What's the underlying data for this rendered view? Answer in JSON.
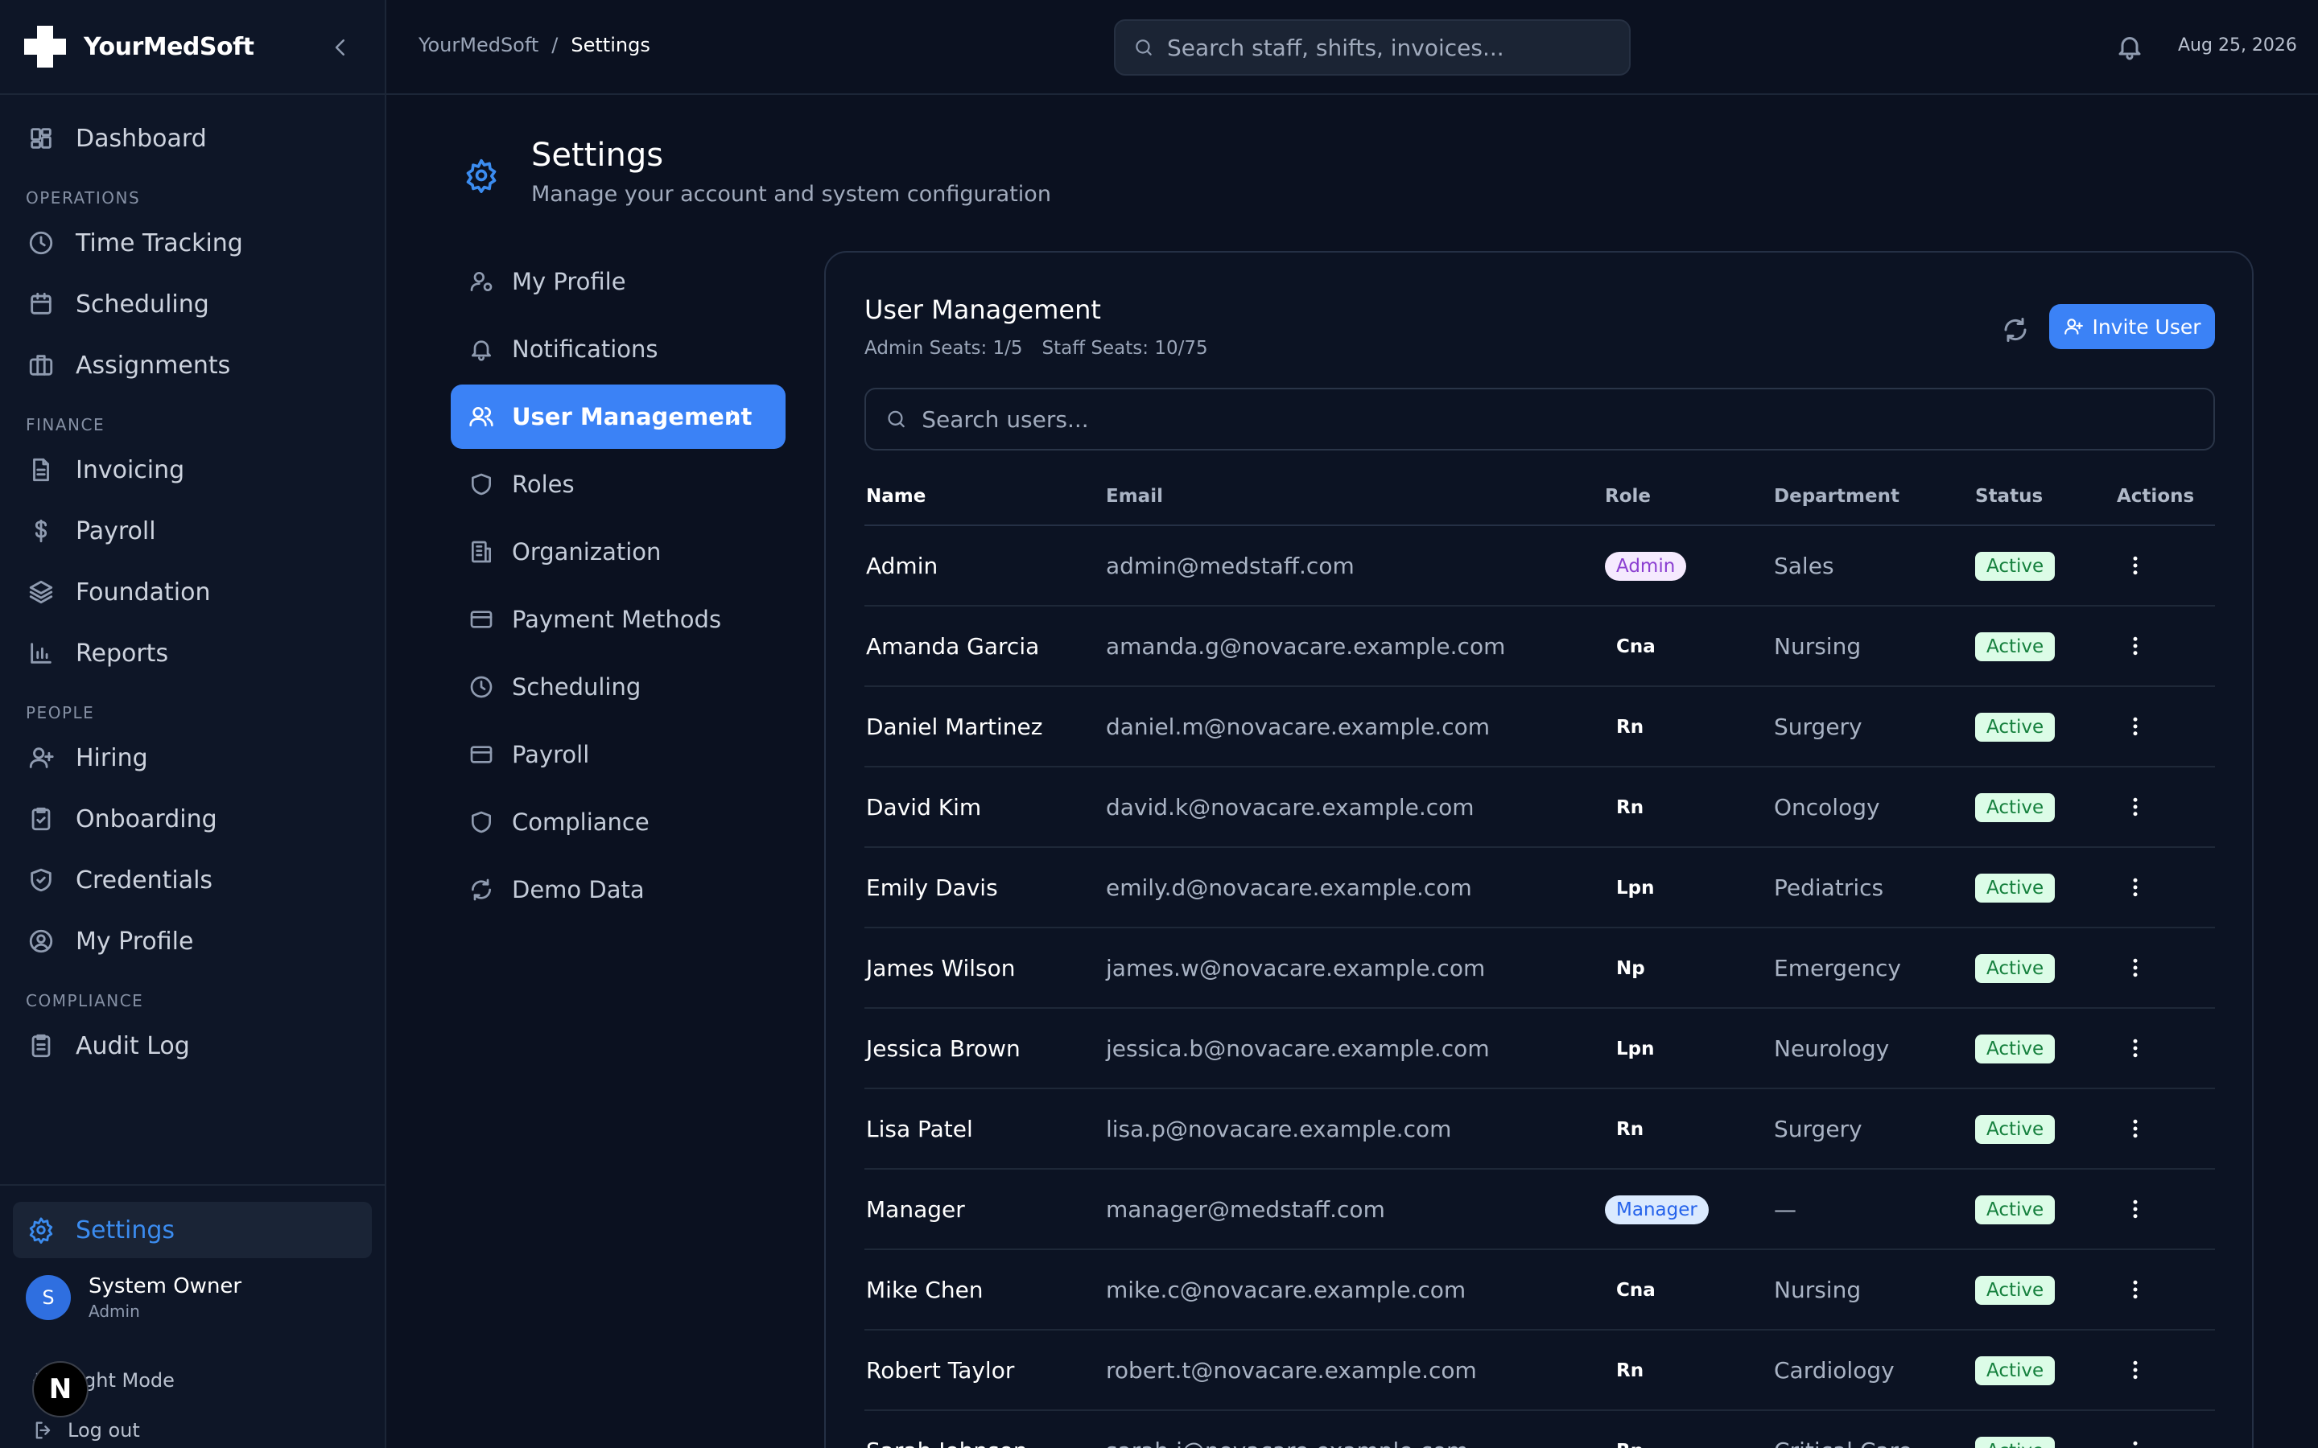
{
  "brand": {
    "name": "YourMedSoft"
  },
  "sidebar": {
    "dashboard": "Dashboard",
    "sections": {
      "operations": "OPERATIONS",
      "finance": "FINANCE",
      "people": "PEOPLE",
      "compliance": "COMPLIANCE"
    },
    "operations_items": [
      {
        "label": "Time Tracking",
        "icon": "clock-icon"
      },
      {
        "label": "Scheduling",
        "icon": "calendar-icon"
      },
      {
        "label": "Assignments",
        "icon": "briefcase-icon"
      }
    ],
    "finance_items": [
      {
        "label": "Invoicing",
        "icon": "file-icon"
      },
      {
        "label": "Payroll",
        "icon": "dollar-icon"
      },
      {
        "label": "Foundation",
        "icon": "layers-icon"
      },
      {
        "label": "Reports",
        "icon": "bar-chart-icon"
      }
    ],
    "people_items": [
      {
        "label": "Hiring",
        "icon": "user-plus-icon"
      },
      {
        "label": "Onboarding",
        "icon": "clipboard-check-icon"
      },
      {
        "label": "Credentials",
        "icon": "shield-check-icon"
      },
      {
        "label": "My Profile",
        "icon": "user-circle-icon"
      }
    ],
    "compliance_items": [
      {
        "label": "Audit Log",
        "icon": "clipboard-list-icon"
      }
    ],
    "settings": "Settings",
    "user": {
      "name": "System Owner",
      "role": "Admin",
      "initial": "S"
    },
    "light_mode": "Light Mode",
    "logout": "Log out"
  },
  "topbar": {
    "breadcrumb": [
      "YourMedSoft",
      "/",
      "Settings"
    ],
    "search_placeholder": "Search staff, shifts, invoices...",
    "date": "Aug 25, 2026"
  },
  "page": {
    "title": "Settings",
    "subtitle": "Manage your account and system configuration"
  },
  "settings_nav": [
    {
      "label": "My Profile",
      "icon": "user-cog-icon",
      "active": false
    },
    {
      "label": "Notifications",
      "icon": "bell-icon",
      "active": false
    },
    {
      "label": "User Management",
      "icon": "users-icon",
      "active": true
    },
    {
      "label": "Roles",
      "icon": "shield-icon",
      "active": false
    },
    {
      "label": "Organization",
      "icon": "building-icon",
      "active": false
    },
    {
      "label": "Payment Methods",
      "icon": "credit-card-icon",
      "active": false
    },
    {
      "label": "Scheduling",
      "icon": "clock-icon",
      "active": false
    },
    {
      "label": "Payroll",
      "icon": "credit-card-icon",
      "active": false
    },
    {
      "label": "Compliance",
      "icon": "shield-icon",
      "active": false
    },
    {
      "label": "Demo Data",
      "icon": "refresh-icon",
      "active": false
    }
  ],
  "user_management": {
    "title": "User Management",
    "admin_seats": "Admin Seats: 1/5",
    "staff_seats": "Staff Seats: 10/75",
    "invite_label": "Invite User",
    "search_placeholder": "Search users...",
    "columns": [
      "Name",
      "Email",
      "Role",
      "Department",
      "Status",
      "Actions"
    ],
    "rows": [
      {
        "name": "Admin",
        "email": "admin@medstaff.com",
        "role": "Admin",
        "role_style": "admin",
        "department": "Sales",
        "status": "Active"
      },
      {
        "name": "Amanda Garcia",
        "email": "amanda.g@novacare.example.com",
        "role": "Cna",
        "role_style": "plain",
        "department": "Nursing",
        "status": "Active"
      },
      {
        "name": "Daniel Martinez",
        "email": "daniel.m@novacare.example.com",
        "role": "Rn",
        "role_style": "plain",
        "department": "Surgery",
        "status": "Active"
      },
      {
        "name": "David Kim",
        "email": "david.k@novacare.example.com",
        "role": "Rn",
        "role_style": "plain",
        "department": "Oncology",
        "status": "Active"
      },
      {
        "name": "Emily Davis",
        "email": "emily.d@novacare.example.com",
        "role": "Lpn",
        "role_style": "plain",
        "department": "Pediatrics",
        "status": "Active"
      },
      {
        "name": "James Wilson",
        "email": "james.w@novacare.example.com",
        "role": "Np",
        "role_style": "plain",
        "department": "Emergency",
        "status": "Active"
      },
      {
        "name": "Jessica Brown",
        "email": "jessica.b@novacare.example.com",
        "role": "Lpn",
        "role_style": "plain",
        "department": "Neurology",
        "status": "Active"
      },
      {
        "name": "Lisa Patel",
        "email": "lisa.p@novacare.example.com",
        "role": "Rn",
        "role_style": "plain",
        "department": "Surgery",
        "status": "Active"
      },
      {
        "name": "Manager",
        "email": "manager@medstaff.com",
        "role": "Manager",
        "role_style": "manager",
        "department": "—",
        "status": "Active"
      },
      {
        "name": "Mike Chen",
        "email": "mike.c@novacare.example.com",
        "role": "Cna",
        "role_style": "plain",
        "department": "Nursing",
        "status": "Active"
      },
      {
        "name": "Robert Taylor",
        "email": "robert.t@novacare.example.com",
        "role": "Rn",
        "role_style": "plain",
        "department": "Cardiology",
        "status": "Active"
      },
      {
        "name": "Sarah Johnson",
        "email": "sarah.j@novacare.example.com",
        "role": "Rn",
        "role_style": "plain",
        "department": "Critical Care",
        "status": "Active"
      }
    ]
  },
  "dev_badge": "N"
}
